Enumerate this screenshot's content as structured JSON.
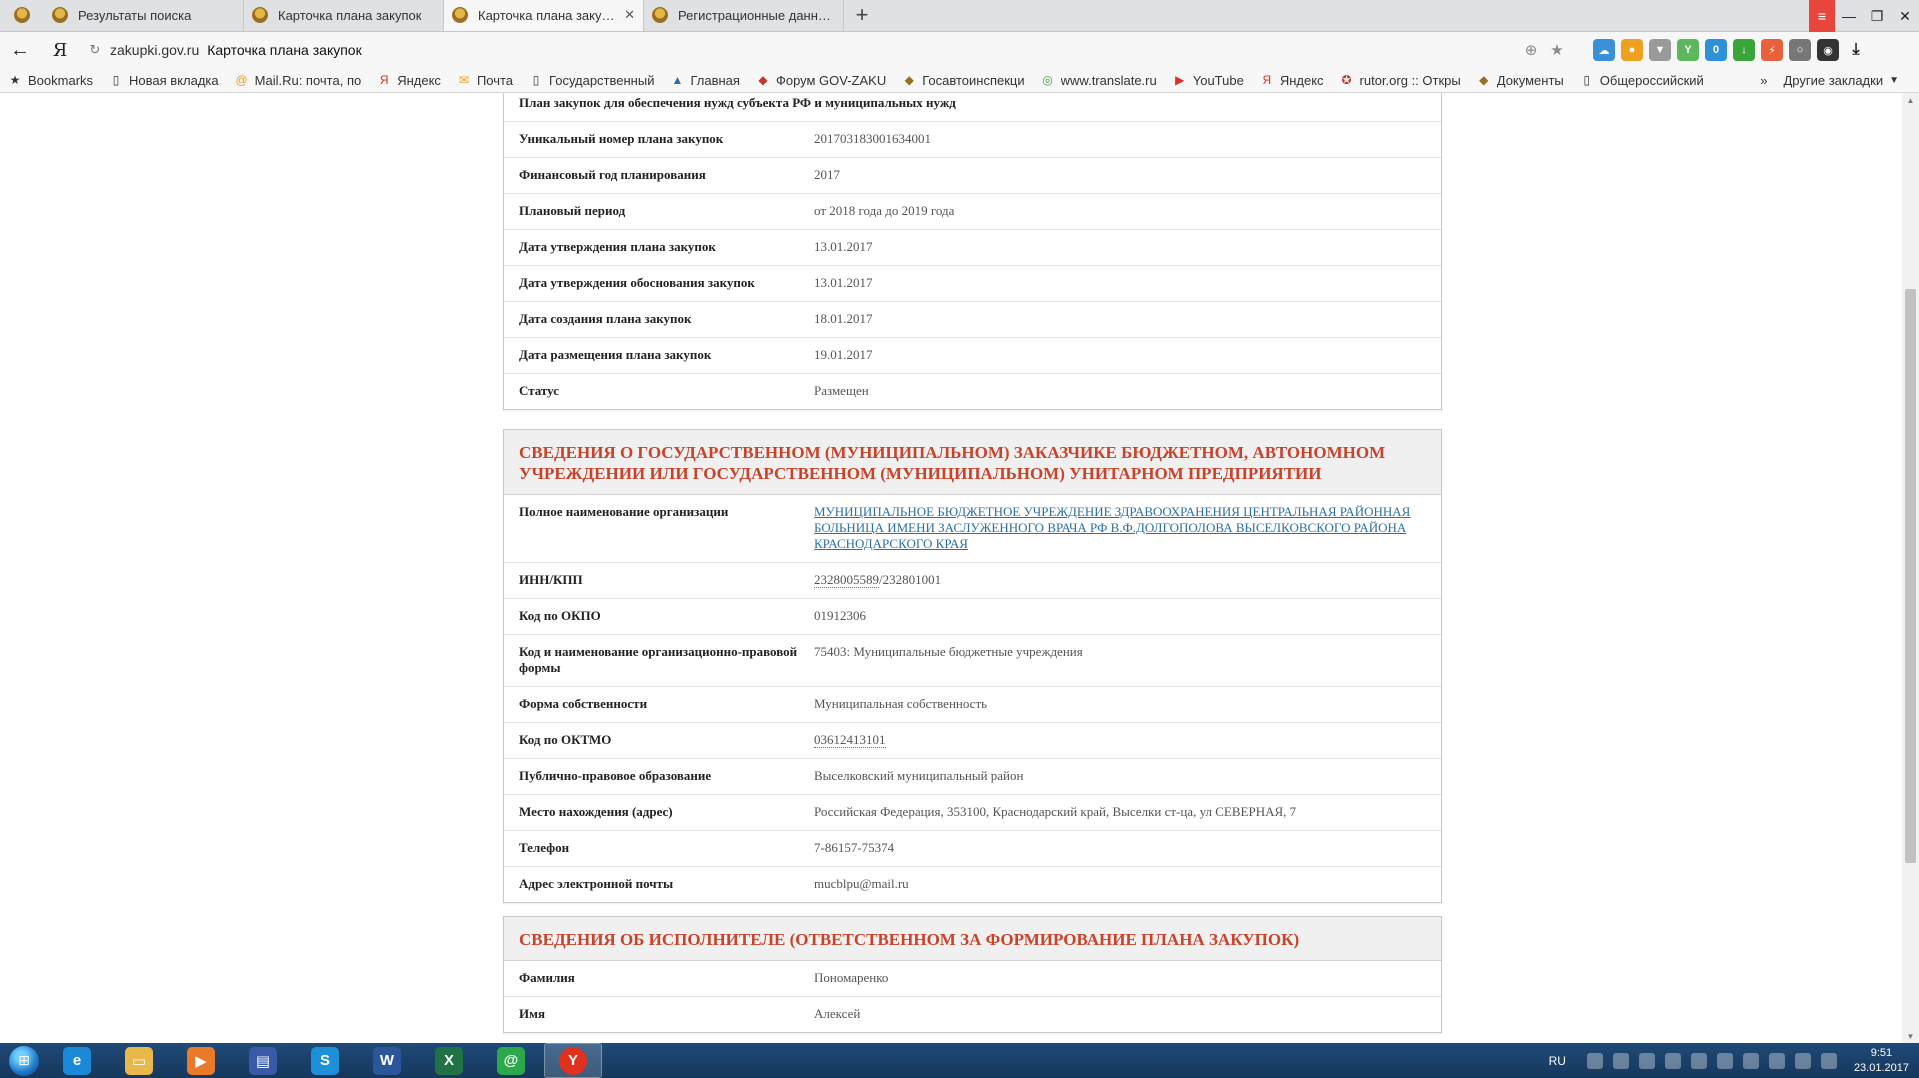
{
  "browser": {
    "tabs": [
      {
        "label": "",
        "active": false
      },
      {
        "label": "Результаты поиска",
        "active": false
      },
      {
        "label": "Карточка плана закупок",
        "active": false
      },
      {
        "label": "Карточка плана закупок",
        "active": true,
        "close": "✕"
      },
      {
        "label": "Регистрационные данные о",
        "active": false
      }
    ],
    "new_tab": "+",
    "url_domain": "zakupki.gov.ru",
    "url_title": "Карточка плана закупок",
    "bookmarks": [
      {
        "label": "Bookmarks",
        "icon": "star-icon"
      },
      {
        "label": "Новая вкладка",
        "icon": "page-icon"
      },
      {
        "label": "Mail.Ru: почта, по",
        "icon": "mailru-icon"
      },
      {
        "label": "Яндекс",
        "icon": "yandex-icon"
      },
      {
        "label": "Почта",
        "icon": "mail-icon"
      },
      {
        "label": "Государственный",
        "icon": "page-icon"
      },
      {
        "label": "Главная",
        "icon": "site-icon"
      },
      {
        "label": "Форум GOV-ZAKU",
        "icon": "emblem-icon"
      },
      {
        "label": "Госавтоинспекци",
        "icon": "emblem-icon"
      },
      {
        "label": "www.translate.ru",
        "icon": "globe-icon"
      },
      {
        "label": "YouTube",
        "icon": "youtube-icon"
      },
      {
        "label": "Яндекс",
        "icon": "yandex-icon"
      },
      {
        "label": "rutor.org :: Откры",
        "icon": "rutor-icon"
      },
      {
        "label": "Документы",
        "icon": "emblem-icon"
      },
      {
        "label": "Общероссийский",
        "icon": "page-icon"
      }
    ],
    "bookmarks_more": "»",
    "other_bookmarks": "Другие закладки"
  },
  "section1": {
    "rows": [
      {
        "label": "План закупок для обеспечения нужд субъекта РФ и муниципальных нужд",
        "value": ""
      },
      {
        "label": "Уникальный номер плана закупок",
        "value": "201703183001634001"
      },
      {
        "label": "Финансовый год планирования",
        "value": "2017"
      },
      {
        "label": "Плановый период",
        "value": "от 2018 года до 2019 года"
      },
      {
        "label": "Дата утверждения плана закупок",
        "value": "13.01.2017"
      },
      {
        "label": "Дата утверждения обоснования закупок",
        "value": "13.01.2017"
      },
      {
        "label": "Дата создания плана закупок",
        "value": "18.01.2017"
      },
      {
        "label": "Дата размещения плана закупок",
        "value": "19.01.2017"
      },
      {
        "label": "Статус",
        "value": "Размещен"
      }
    ]
  },
  "section2": {
    "title": "СВЕДЕНИЯ О ГОСУДАРСТВЕННОМ (МУНИЦИПАЛЬНОМ) ЗАКАЗЧИКЕ БЮДЖЕТНОМ, АВТОНОМНОМ УЧРЕЖДЕНИИ ИЛИ ГОСУДАРСТВЕННОМ (МУНИЦИПАЛЬНОМ) УНИТАРНОМ ПРЕДПРИЯТИИ",
    "org_label": "Полное наименование организации",
    "org_value": "МУНИЦИПАЛЬНОЕ БЮДЖЕТНОЕ УЧРЕЖДЕНИЕ ЗДРАВООХРАНЕНИЯ ЦЕНТРАЛЬНАЯ РАЙОННАЯ БОЛЬНИЦА ИМЕНИ ЗАСЛУЖЕННОГО ВРАЧА РФ В.Ф.ДОЛГОПОЛОВА ВЫСЕЛКОВСКОГО РАЙОНА КРАСНОДАРСКОГО КРАЯ",
    "inn_label": "ИНН/КПП",
    "inn": "2328005589",
    "kpp": "/232801001",
    "okpo_label": "Код по ОКПО",
    "okpo": "01912306",
    "opf_label": "Код и наименование организационно-правовой формы",
    "opf": "75403: Муниципальные бюджетные учреждения",
    "own_label": "Форма собственности",
    "own": "Муниципальная собственность",
    "oktmo_label": "Код по ОКТМО",
    "oktmo": "03612413101",
    "ppo_label": "Публично-правовое образование",
    "ppo": "Выселковский муниципальный район",
    "addr_label": "Место нахождения (адрес)",
    "addr": "Российская Федерация, 353100, Краснодарский край, Выселки ст-ца, ул СЕВЕРНАЯ, 7",
    "phone_label": "Телефон",
    "phone": "7-86157-75374",
    "email_label": "Адрес электронной почты",
    "email": "mucblpu@mail.ru"
  },
  "section3": {
    "title": "СВЕДЕНИЯ ОБ ИСПОЛНИТЕЛЕ (ОТВЕТСТВЕННОМ ЗА ФОРМИРОВАНИЕ ПЛАНА ЗАКУПОК)",
    "surname_label": "Фамилия",
    "surname": "Пономаренко",
    "name_label": "Имя",
    "name": "Алексей"
  },
  "taskbar": {
    "lang": "RU",
    "time": "9:51",
    "date": "23.01.2017"
  },
  "colors": {
    "section_title": "#c8432a",
    "link": "#2a6fa8",
    "taskbar": "#1f4a78"
  }
}
